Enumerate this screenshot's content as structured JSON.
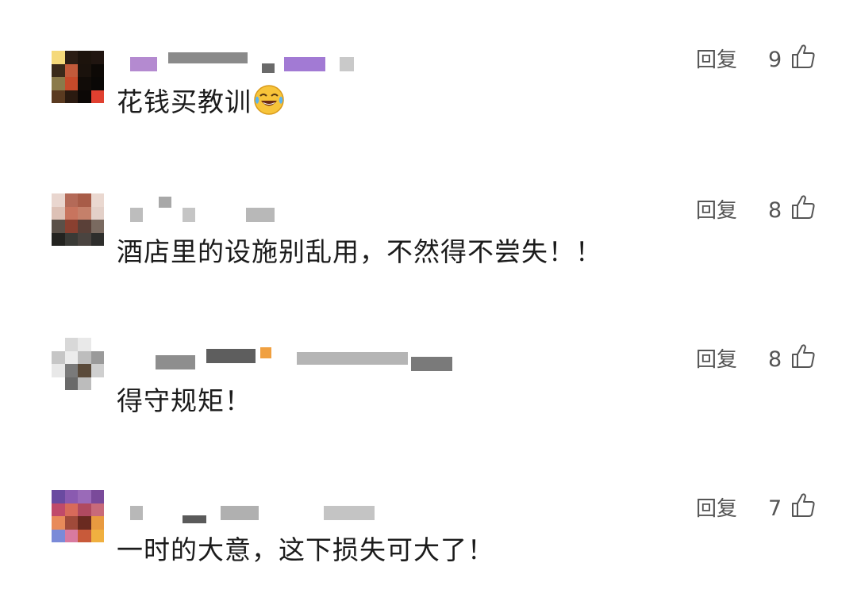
{
  "comments": [
    {
      "text": "花钱买教训",
      "emoji": "tears-of-joy-emoji",
      "reply_label": "回复",
      "likes": "9",
      "avatar": [
        "#f5d97a",
        "#2b1d14",
        "#1c130c",
        "#201510",
        "#3a2a1a",
        "#c25a3a",
        "#1a120c",
        "#0d0906",
        "#8a7a4a",
        "#c64a2a",
        "#110c08",
        "#0a0806",
        "#5a3a20",
        "#2a1a10",
        "#0c0806",
        "#e04030"
      ],
      "username_blocks": [
        {
          "color": "#b48ad0"
        },
        {
          "color": "#8a8a8a"
        },
        {
          "color": "#6a6a6a"
        },
        {
          "color": "#a27ad4"
        },
        {
          "color": "#c9c9c9"
        }
      ]
    },
    {
      "text": "酒店里的设施别乱用，不然得不尝失！！",
      "reply_label": "回复",
      "likes": "8",
      "avatar": [
        "#e9d6cf",
        "#b46a58",
        "#a85c48",
        "#ead8d0",
        "#ddc1b6",
        "#c8745e",
        "#c5806a",
        "#e3d0c8",
        "#5a5048",
        "#8a4030",
        "#5a4038",
        "#7a6a60",
        "#232320",
        "#3a3a36",
        "#4a4440",
        "#2e2e2c"
      ],
      "username_blocks": [
        {
          "color": "#bdbdbd"
        },
        {
          "color": "#a8a8a8"
        },
        {
          "color": "#c5c5c5"
        },
        {
          "color": "#b8b8b8"
        }
      ]
    },
    {
      "text": "得守规矩！",
      "reply_label": "回复",
      "likes": "8",
      "avatar": [
        "#ffffff",
        "#d8d8d8",
        "#e9e9e9",
        "#ffffff",
        "#c6c6c6",
        "#ececec",
        "#bdbdbd",
        "#9a9a9a",
        "#e8e8e8",
        "#7a7a7a",
        "#5a4a3a",
        "#cfcfcf",
        "#ffffff",
        "#6a6a6a",
        "#bcbcbc",
        "#ffffff"
      ],
      "username_blocks": [
        {
          "color": "#8e8e8e"
        },
        {
          "color": "#5e5e5e"
        },
        {
          "color": "#f0a040"
        },
        {
          "color": "#b5b5b5"
        },
        {
          "color": "#7a7a7a"
        }
      ]
    },
    {
      "text": "一时的大意，这下损失可大了！",
      "reply_label": "回复",
      "likes": "7",
      "avatar": [
        "#6a4aa0",
        "#8a5ab0",
        "#9a6ab8",
        "#7a4a9a",
        "#c04a6a",
        "#d86a5a",
        "#b04a60",
        "#c86a7a",
        "#e88a5a",
        "#a04a3a",
        "#6a2a20",
        "#e89a40",
        "#7a8ad8",
        "#d87aa0",
        "#c85a3a",
        "#f0b040"
      ],
      "username_blocks": [
        {
          "color": "#b8b8b8"
        },
        {
          "color": "#5a5a5a"
        },
        {
          "color": "#b0b0b0"
        },
        {
          "color": "#c4c4c4"
        }
      ]
    }
  ],
  "colors": {
    "text": "#1b1b1b",
    "secondary": "#555555",
    "background": "#ffffff"
  }
}
